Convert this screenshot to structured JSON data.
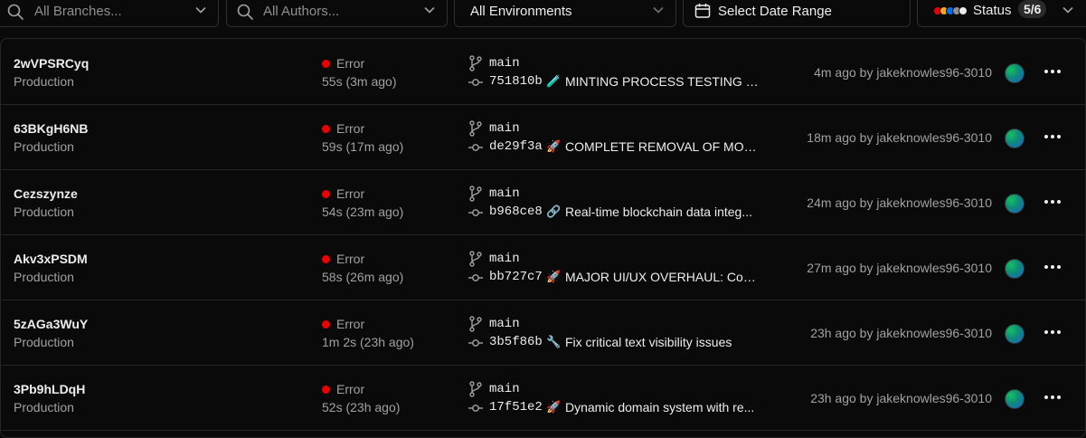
{
  "filters": {
    "branches_placeholder": "All Branches...",
    "authors_placeholder": "All Authors...",
    "environment": "All Environments",
    "date_range": "Select Date Range",
    "status_label": "Status",
    "status_count": "5/6",
    "status_dot_colors": [
      "#ee0000",
      "#f5a623",
      "#0070f3",
      "#8f8f8f",
      "#ededed"
    ]
  },
  "colors": {
    "error": "#ee0000",
    "background": "#0a0a0a",
    "border": "#262626",
    "muted_text": "#a1a1a1"
  },
  "deployments": [
    {
      "id": "2wVPSRCyq",
      "environment": "Production",
      "status": "Error",
      "duration": "55s (3m ago)",
      "branch": "main",
      "sha": "751810b",
      "emoji": "🧪",
      "message": "MINTING PROCESS TESTING & F...",
      "meta": "4m ago by jakeknowles96-3010"
    },
    {
      "id": "63BKgH6NB",
      "environment": "Production",
      "status": "Error",
      "duration": "59s (17m ago)",
      "branch": "main",
      "sha": "de29f3a",
      "emoji": "🚀",
      "message": "COMPLETE REMOVAL OF MOCK...",
      "meta": "18m ago by jakeknowles96-3010"
    },
    {
      "id": "Cezszynze",
      "environment": "Production",
      "status": "Error",
      "duration": "54s (23m ago)",
      "branch": "main",
      "sha": "b968ce8",
      "emoji": "🔗",
      "message": "Real-time blockchain data integ...",
      "meta": "24m ago by jakeknowles96-3010"
    },
    {
      "id": "Akv3xPSDM",
      "environment": "Production",
      "status": "Error",
      "duration": "58s (26m ago)",
      "branch": "main",
      "sha": "bb727c7",
      "emoji": "🚀",
      "message": "MAJOR UI/UX OVERHAUL: Com...",
      "meta": "27m ago by jakeknowles96-3010"
    },
    {
      "id": "5zAGa3WuY",
      "environment": "Production",
      "status": "Error",
      "duration": "1m 2s (23h ago)",
      "branch": "main",
      "sha": "3b5f86b",
      "emoji": "🔧",
      "message": "Fix critical text visibility issues",
      "meta": "23h ago by jakeknowles96-3010"
    },
    {
      "id": "3Pb9hLDqH",
      "environment": "Production",
      "status": "Error",
      "duration": "52s (23h ago)",
      "branch": "main",
      "sha": "17f51e2",
      "emoji": "🚀",
      "message": "Dynamic domain system with re...",
      "meta": "23h ago by jakeknowles96-3010"
    }
  ]
}
